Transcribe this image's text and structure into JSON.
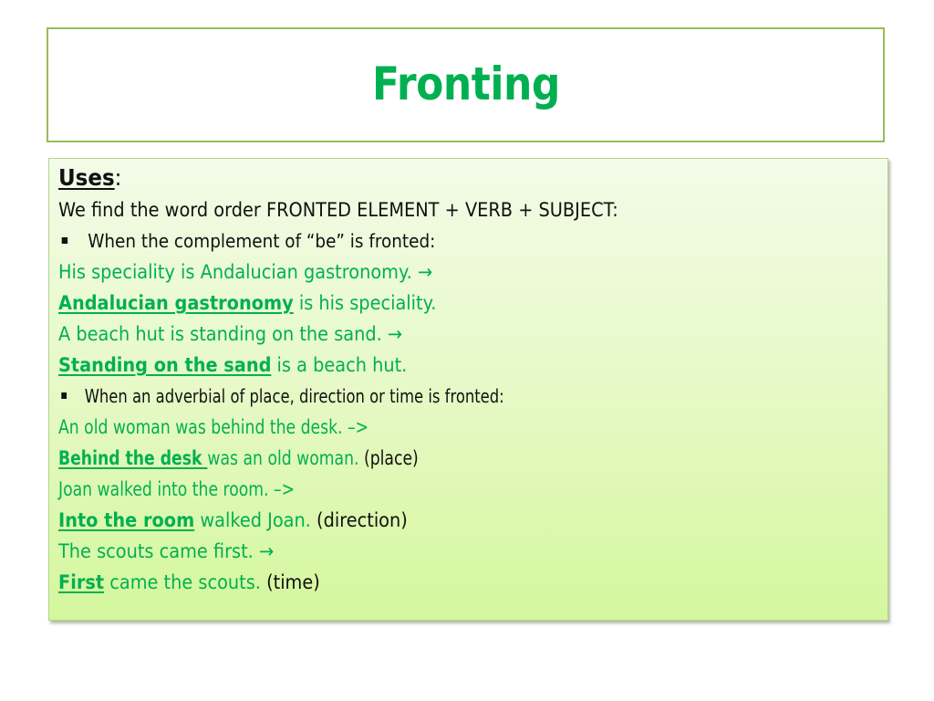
{
  "slide": {
    "title": "Fronting",
    "colors": {
      "accent_green": "#00b050",
      "border_green": "#9bbb59",
      "text": "#111111"
    },
    "uses_heading": "Uses",
    "uses_colon": ":",
    "intro": "We find the word order FRONTED ELEMENT + VERB + SUBJECT:",
    "bullets": [
      {
        "icon": "square-bullet-icon",
        "text": "When the complement of “be” is fronted:",
        "examples": [
          {
            "plain": "His speciality is Andalucian gastronomy.",
            "arrow": "→"
          },
          {
            "fronted": "Andalucian gastronomy",
            "rest": " is his speciality."
          },
          {
            "plain": "A beach hut is standing on the sand.",
            "arrow": "→"
          },
          {
            "fronted": "Standing on the sand",
            "rest": " is a beach hut."
          }
        ]
      },
      {
        "icon": "square-bullet-icon",
        "text": "When an adverbial of place, direction or time is fronted:",
        "examples": [
          {
            "plain": "An old woman was behind the desk. –>"
          },
          {
            "fronted": "Behind the desk ",
            "rest": "was an old woman.",
            "note": " (place)"
          },
          {
            "plain": "Joan walked into the room. –>"
          },
          {
            "fronted": "Into the room",
            "rest": " walked Joan.",
            "note": " (direction)"
          },
          {
            "plain": "The scouts came first.",
            "arrow": "→"
          },
          {
            "fronted": "First",
            "rest": " came the scouts.",
            "note": " (time)"
          }
        ]
      }
    ]
  }
}
